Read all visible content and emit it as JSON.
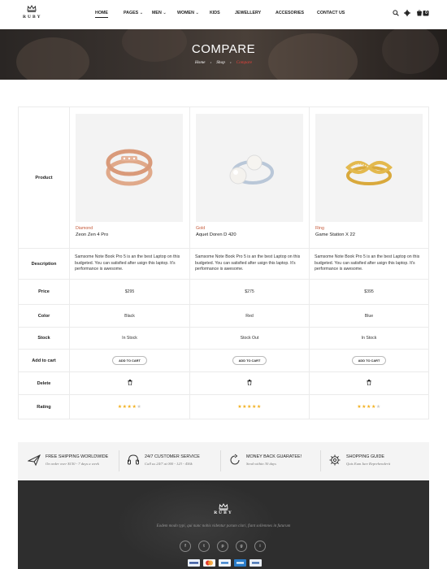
{
  "logo": {
    "text": "RUBY"
  },
  "nav": {
    "items": [
      {
        "label": "HOME",
        "active": true
      },
      {
        "label": "PAGES"
      },
      {
        "label": "MEN"
      },
      {
        "label": "WOMEN"
      },
      {
        "label": "KIDS"
      },
      {
        "label": "JEWELLERY"
      },
      {
        "label": "ACCESORIES"
      },
      {
        "label": "CONTACT US"
      }
    ],
    "cart_count": "0"
  },
  "hero": {
    "title": "COMPARE",
    "breadcrumb": [
      "Home",
      "Shop",
      "Compare"
    ]
  },
  "compare": {
    "labels": {
      "product": "Product",
      "description": "Description",
      "price": "Price",
      "color": "Color",
      "stock": "Stock",
      "add_to_cart": "Add to cart",
      "delete": "Delete",
      "rating": "Rating"
    },
    "button_label": "ADD TO CART",
    "products": [
      {
        "category": "Diamond",
        "name": "Zeon Zen 4 Pro",
        "description": "Samsome Note Book Pro 5 is an the best Laptop on this budgeted. You can satisfied after usign this laptop. It's performance is awesome.",
        "price": "$295",
        "color": "Black",
        "stock": "In Stock",
        "rating": 4
      },
      {
        "category": "Gold",
        "name": "Aquet Doren D 420",
        "description": "Samsome Note Book Pro 5 is an the best Laptop on this budgeted. You can satisfied after usign this laptop. It's performance is awesome.",
        "price": "$275",
        "color": "Red",
        "stock": "Stock Out",
        "rating": 5
      },
      {
        "category": "Ring",
        "name": "Game Station X 22",
        "description": "Samsome Note Book Pro 5 is an the best Laptop on this budgeted. You can satisfied after usign this laptop. It's performance is awesome.",
        "price": "$395",
        "color": "Blue",
        "stock": "In Stock",
        "rating": 4
      }
    ]
  },
  "services": [
    {
      "icon": "plane-icon",
      "title": "FREE SHIPPING WORLDWIDE",
      "subtitle": "On order over $150 - 7 days a week"
    },
    {
      "icon": "headset-icon",
      "title": "24/7 CUSTOMER SERVICE",
      "subtitle": "Call us 24/7 at 000 - 123 - 456k"
    },
    {
      "icon": "refresh-icon",
      "title": "MONEY BACK GUARATEE!",
      "subtitle": "Send within 30 days"
    },
    {
      "icon": "gear-icon",
      "title": "SHOPPING GUIDE",
      "subtitle": "Quis Eum Iure Reprehenderit"
    }
  ],
  "footer": {
    "logo_text": "RUBY",
    "text": "Eodem modo typi, qui nunc nobis videntur parum clari, fiant sollemnes in futurum",
    "social": [
      "f",
      "t",
      "p",
      "g",
      "i"
    ],
    "payments": [
      "visa",
      "mastercard",
      "paypal",
      "amex",
      "paypal-2"
    ]
  },
  "colors": {
    "accent": "#e8413b",
    "category": "#c55a3a",
    "star": "#f2b01e",
    "footer_bg": "#2e2e2e"
  }
}
